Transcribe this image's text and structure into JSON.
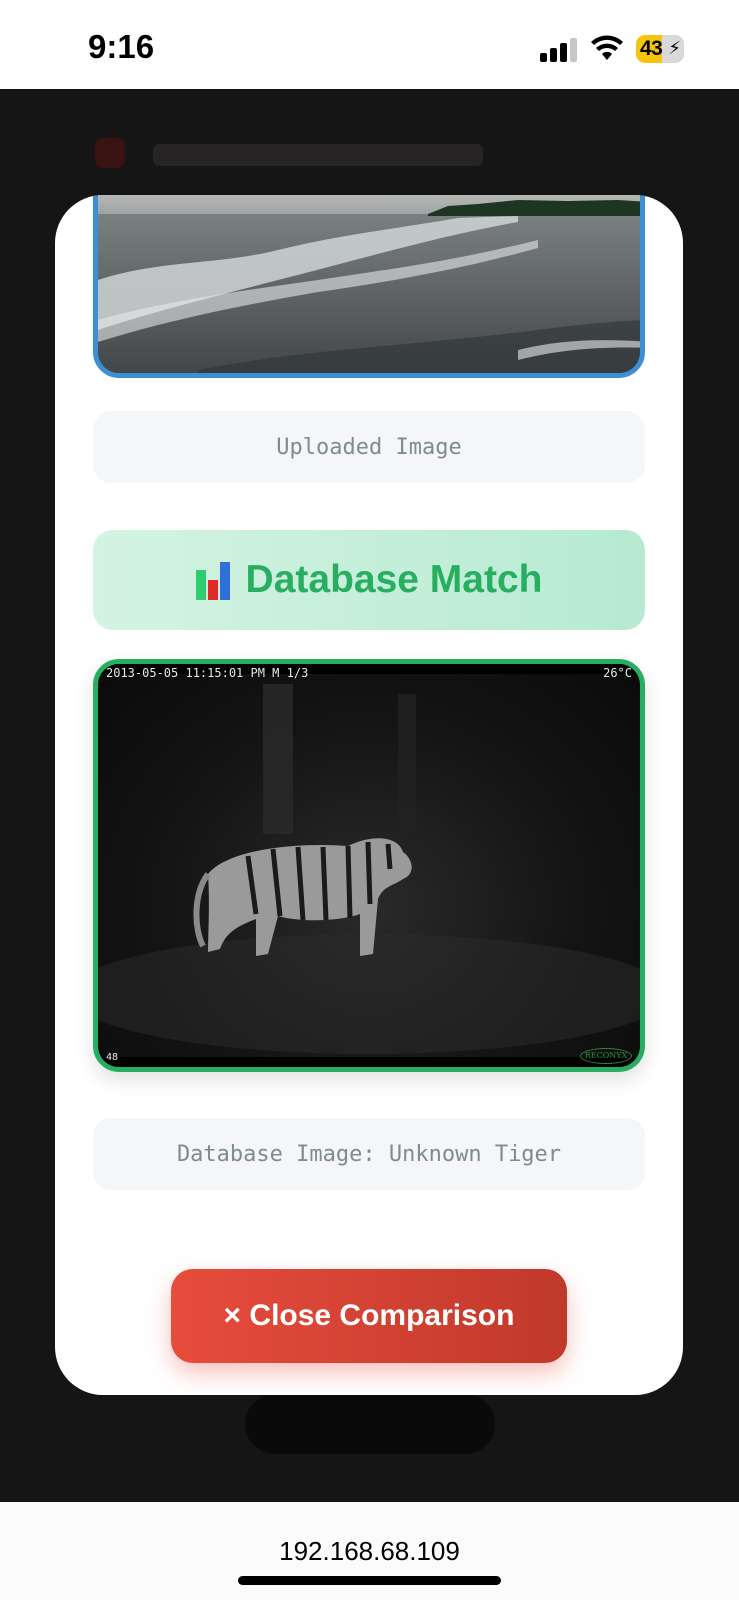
{
  "status_bar": {
    "time": "9:16",
    "battery_level": "43",
    "battery_color": "#f5c50c"
  },
  "modal": {
    "uploaded_caption": "Uploaded Image",
    "match_icon": "bar-chart-icon",
    "match_title": "Database Match",
    "database_caption": "Database Image: Unknown Tiger",
    "camera_stamp_left": "2013-05-05 11:15:01 PM  M 1/3",
    "camera_stamp_right": "26°C",
    "camera_footer": "48",
    "camera_brand": "RECONYX",
    "close_label": "× Close Comparison",
    "colors": {
      "uploaded_border": "#3d8fd4",
      "match_accent": "#27ae60",
      "close_button": "#e74c3c"
    }
  },
  "browser": {
    "url": "192.168.68.109"
  }
}
